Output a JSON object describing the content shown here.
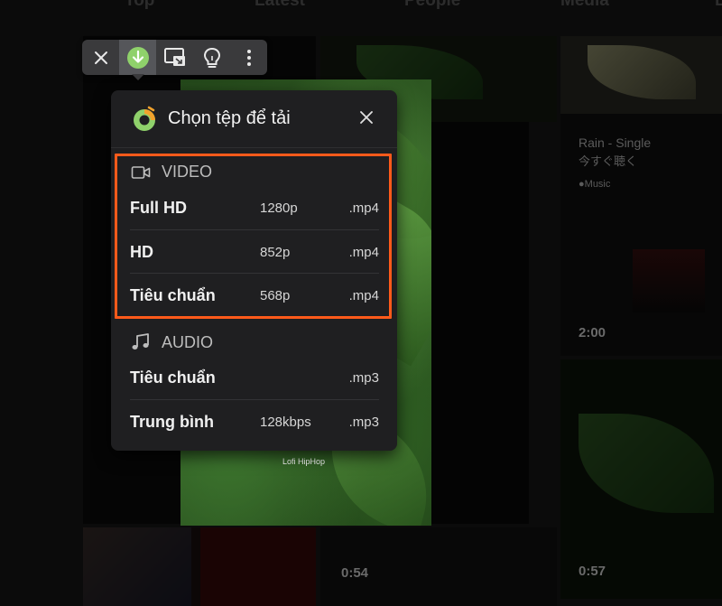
{
  "background": {
    "nav_tabs": [
      "Top",
      "Latest",
      "People",
      "Media",
      "L"
    ],
    "card_title": "Rain - Single",
    "card_subtitle": "今すぐ聴く",
    "card_source": "Music",
    "durations": [
      "2:00",
      "0:54",
      "0:57"
    ],
    "video_caption": "Lofi HipHop"
  },
  "toolbar": {
    "items": [
      {
        "icon": "close-icon"
      },
      {
        "icon": "download-icon"
      },
      {
        "icon": "picture-in-picture-icon"
      },
      {
        "icon": "lightbulb-icon"
      },
      {
        "icon": "more-vertical-icon"
      }
    ],
    "accent": "#8fd16b"
  },
  "popup": {
    "title": "Chọn tệp để tải",
    "video_section": {
      "label": "VIDEO",
      "rows": [
        {
          "name": "Full HD",
          "resolution": "1280p",
          "ext": ".mp4"
        },
        {
          "name": "HD",
          "resolution": "852p",
          "ext": ".mp4"
        },
        {
          "name": "Tiêu chuẩn",
          "resolution": "568p",
          "ext": ".mp4"
        }
      ]
    },
    "audio_section": {
      "label": "AUDIO",
      "rows": [
        {
          "name": "Tiêu chuẩn",
          "resolution": "",
          "ext": ".mp3"
        },
        {
          "name": "Trung bình",
          "resolution": "128kbps",
          "ext": ".mp3"
        }
      ]
    },
    "highlight_color": "#ff5a1a"
  }
}
